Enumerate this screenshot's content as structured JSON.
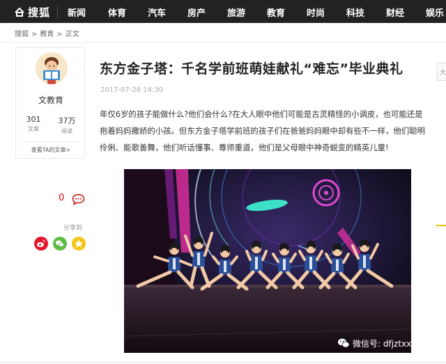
{
  "header": {
    "logo_text": "搜狐",
    "nav_items": [
      "新闻",
      "体育",
      "汽车",
      "房产",
      "旅游",
      "教育",
      "时尚",
      "科技",
      "财经",
      "娱乐"
    ]
  },
  "breadcrumb": [
    "搜狐",
    "教育",
    "正文"
  ],
  "author": {
    "name": "文教育",
    "articles_count": "301",
    "articles_label": "文章",
    "reads_count": "37万",
    "reads_label": "阅读",
    "view_articles_label": "查看TA的文章>"
  },
  "social": {
    "like_count": "0",
    "share_label": "分享到"
  },
  "article": {
    "title": "东方金子塔：千名学前班萌娃献礼“难忘”毕业典礼",
    "date": "2017-07-26 14:30",
    "body": "年仅6岁的孩子能做什么?他们会什么?在大人眼中他们可能是古灵精怪的小调皮，也可能还是抱着妈妈撒娇的小孩。但东方金子塔学前班的孩子们在爸爸妈妈眼中却有些不一样，他们聪明伶俐、能歌善舞，他们听话懂事、尊师重道，他们是父母眼中神奇蜕变的精英儿童!"
  },
  "image": {
    "watermark": "微信号: dfjztxx"
  },
  "right_widget_text": "大",
  "colors": {
    "nav_bg": "#222222",
    "accent_red": "#cc0000",
    "weibo": "#e6162d",
    "wechat": "#5fbb46",
    "qzone": "#f5c518"
  }
}
